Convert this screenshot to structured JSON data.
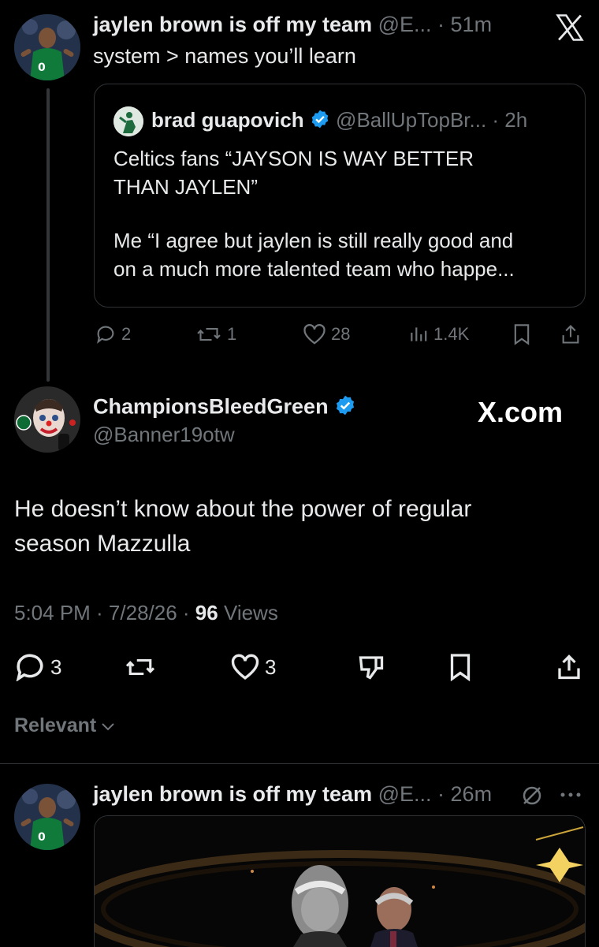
{
  "top_post": {
    "author_name": "jaylen brown is off my team",
    "author_handle": "@E...",
    "time": "51m",
    "text": "system > names you’ll learn",
    "quote": {
      "author_name": "brad guapovich",
      "author_handle": "@BallUpTopBr...",
      "time": "2h",
      "text_line1": "Celtics fans “JAYSON IS WAY BETTER",
      "text_line2": "THAN JAYLEN”",
      "text_line3": "Me “I agree but jaylen is still really good and",
      "text_line4": "on a much more talented team who happe..."
    },
    "actions": {
      "replies": "2",
      "reposts": "1",
      "likes": "28",
      "views": "1.4K"
    }
  },
  "main_post": {
    "author_name": "ChampionsBleedGreen",
    "author_handle": "@Banner19otw",
    "watermark": "X.com",
    "text_line1": "He doesn’t know about the power of regular",
    "text_line2": "season Mazzulla",
    "timestamp": "5:04 PM · 7/28/26 · ",
    "views_count": "96",
    "views_label": " Views",
    "actions": {
      "replies": "3",
      "likes": "3"
    }
  },
  "sort_label": "Relevant",
  "bottom_post": {
    "author_name": "jaylen brown is off my team",
    "author_handle": "@E...",
    "time": "26m"
  },
  "colors": {
    "accent": "#1d9bf0",
    "celtics_green": "#007a33",
    "muted": "#71767b",
    "background": "#000000"
  }
}
